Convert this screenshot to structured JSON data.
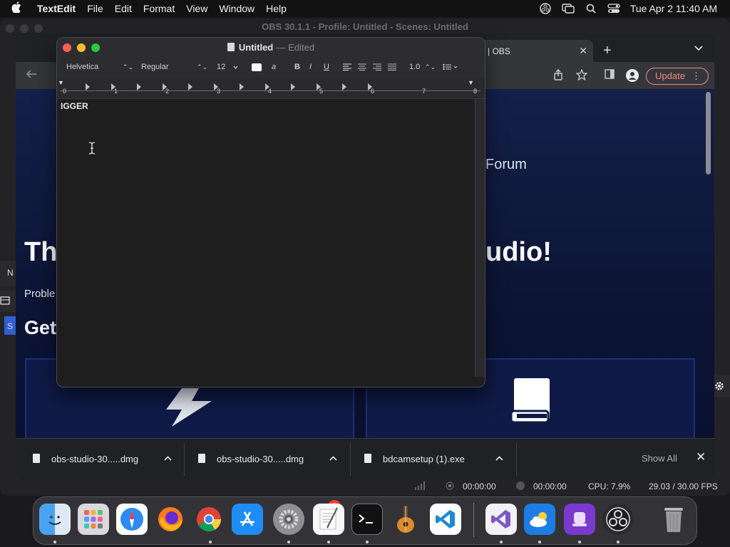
{
  "menubar": {
    "app_name": "TextEdit",
    "items": [
      "File",
      "Edit",
      "Format",
      "View",
      "Window",
      "Help"
    ],
    "datetime": "Tue Apr 2  11:40 AM"
  },
  "obs": {
    "title": "OBS 30.1.1 - Profile: Untitled - Scenes: Untitled",
    "side_labels": [
      "N",
      "S"
    ],
    "status": {
      "rec_time": "00:00:00",
      "stream_time": "00:00:00",
      "cpu": "CPU: 7.9%",
      "fps": "29.03 / 30.00 FPS"
    }
  },
  "chrome": {
    "tab_title": "| OBS",
    "update_label": "Update",
    "page": {
      "forum": "Forum",
      "hero_left": "Th",
      "hero_right": "udio!",
      "problem": "Proble",
      "get": "Get"
    },
    "downloads": [
      {
        "name": "obs-studio-30.....dmg"
      },
      {
        "name": "obs-studio-30.....dmg"
      },
      {
        "name": "bdcamsetup (1).exe"
      }
    ],
    "show_all": "Show All"
  },
  "textedit": {
    "doc_name": "Untitled",
    "sep": "—",
    "status": "Edited",
    "font_family": "Helvetica",
    "font_style": "Regular",
    "font_size": "12",
    "bold_label": "B",
    "italic_label": "I",
    "underline_label": "U",
    "line_spacing": "1.0",
    "ruler_numbers": [
      "0",
      "1",
      "2",
      "3",
      "4",
      "5",
      "6",
      "7",
      "8"
    ],
    "content": "IGGER"
  },
  "dock": {
    "notification_badge": "1",
    "apps": [
      "Finder",
      "Launchpad",
      "Safari",
      "Firefox",
      "Chrome",
      "App Store",
      "System Settings",
      "TextEdit",
      "Terminal",
      "GarageBand",
      "VS Code",
      "Visual Studio",
      "iCloud Weather",
      "Podcast App",
      "OBS",
      "Trash"
    ]
  },
  "colors": {
    "accent_update": "#f28b82",
    "page_bg": "#0c1535",
    "close_red": "#ff5f57",
    "minimize_yellow": "#febc2e",
    "zoom_green": "#28c840"
  }
}
